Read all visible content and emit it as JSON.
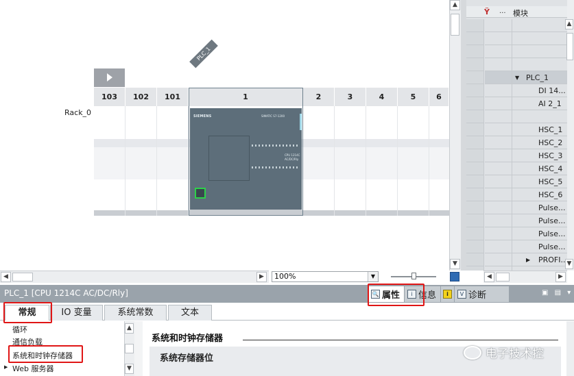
{
  "device_view": {
    "plc_tag": "PLC_1",
    "rack_label": "Rack_0",
    "slots": [
      "103",
      "102",
      "101",
      "1",
      "2",
      "3",
      "4",
      "5",
      "6"
    ],
    "cpu_module": {
      "brand": "SIEMENS",
      "series": "SIMATIC S7-1200",
      "model_line1": "CPU 1214C",
      "model_line2": "AC/DC/Rly"
    }
  },
  "module_table": {
    "header_icon": "filter-icon",
    "header_dots": "...",
    "header_title": "模块",
    "rows": [
      {
        "name": ""
      },
      {
        "name": ""
      },
      {
        "name": ""
      },
      {
        "name": ""
      },
      {
        "name": "PLC_1",
        "expander": "▼"
      },
      {
        "name": "DI 14..."
      },
      {
        "name": "AI 2_1"
      },
      {
        "name": ""
      },
      {
        "name": "HSC_1"
      },
      {
        "name": "HSC_2"
      },
      {
        "name": "HSC_3"
      },
      {
        "name": "HSC_4"
      },
      {
        "name": "HSC_5"
      },
      {
        "name": "HSC_6"
      },
      {
        "name": "Pulse..."
      },
      {
        "name": "Pulse..."
      },
      {
        "name": "Pulse..."
      },
      {
        "name": "Pulse..."
      },
      {
        "name": "PROFI...",
        "expander": "▶"
      },
      {
        "name": ""
      }
    ]
  },
  "zoom": {
    "value": "100%"
  },
  "inspector": {
    "title": "PLC_1 [CPU 1214C AC/DC/Rly]",
    "tabs": [
      {
        "label": "属性",
        "icon": "properties-icon",
        "active": true
      },
      {
        "label": "信息",
        "icon": "info-icon",
        "active": false
      },
      {
        "label": "",
        "icon": "warning-info-icon",
        "active": false
      },
      {
        "label": "诊断",
        "icon": "diagnostics-icon",
        "active": false
      }
    ],
    "category_tabs": [
      {
        "label": "常规",
        "active": true
      },
      {
        "label": "IO 变量",
        "active": false
      },
      {
        "label": "系统常数",
        "active": false
      },
      {
        "label": "文本",
        "active": false
      }
    ],
    "nav_items": [
      {
        "label": "循环"
      },
      {
        "label": "通信负载"
      },
      {
        "label": "系统和时钟存储器"
      },
      {
        "label": "Web 服务器",
        "expander": "▶"
      }
    ],
    "section_title": "系统和时钟存储器",
    "subsection_title": "系统存储器位"
  },
  "watermark": {
    "text": "电子技术控"
  },
  "colors": {
    "highlight": "#e01515",
    "accent": "#2f6bb3"
  }
}
